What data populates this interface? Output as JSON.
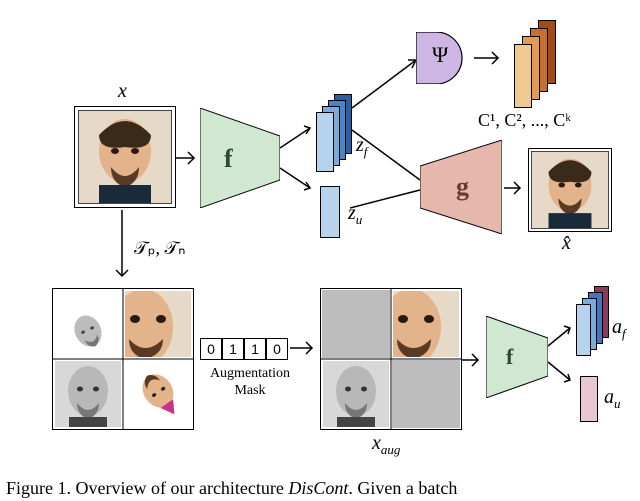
{
  "labels": {
    "x": "x",
    "x_hat": "x̂",
    "x_aug": "x",
    "x_aug_sub": "aug",
    "zf": "z",
    "zf_sub": "f",
    "zu": "z",
    "zu_sub": "u",
    "af": "a",
    "af_sub": "f",
    "au": "a",
    "au_sub": "u",
    "psi": "Ψ",
    "f": "f",
    "g": "g",
    "transforms": "𝒯ₚ, 𝒯ₙ",
    "augmentation": "Augmentation",
    "mask": "Mask",
    "classifiers": "C¹, C², ..., Cᵏ"
  },
  "augmask_values": [
    "0",
    "1",
    "1",
    "0"
  ],
  "caption_prefix": "Figure 1.",
  "caption_text": " Overview of our architecture ",
  "caption_em": "DisCont",
  "caption_tail": ". Given a batch"
}
